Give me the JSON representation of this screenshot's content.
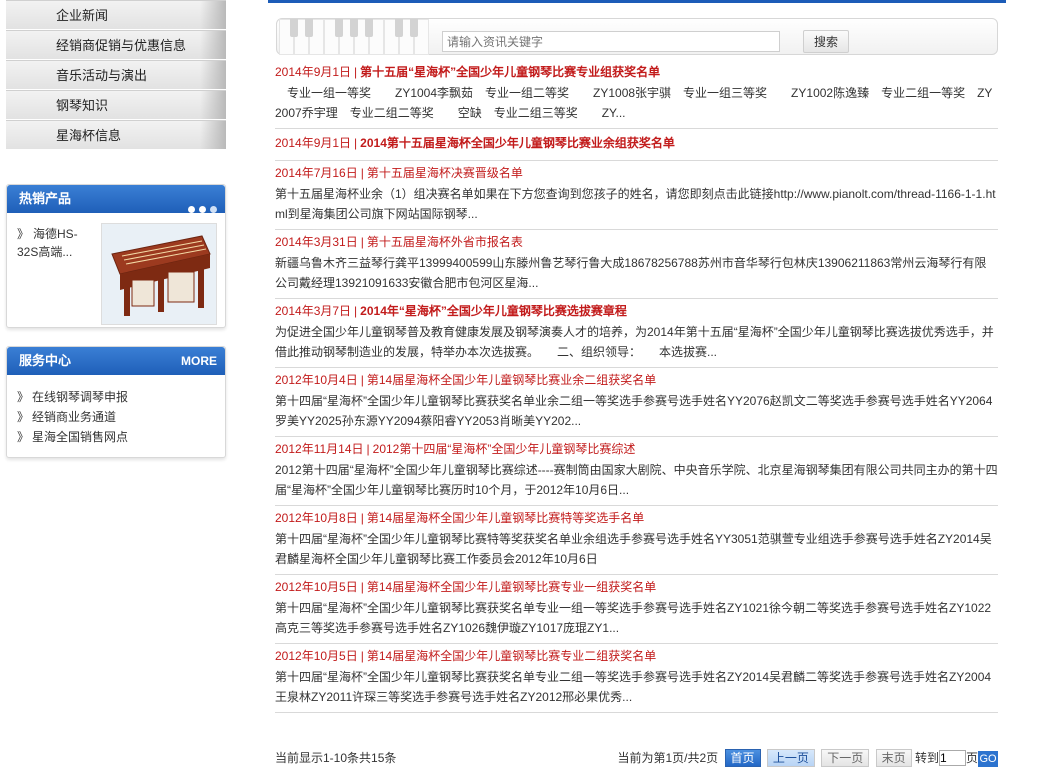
{
  "categories": [
    "企业新闻",
    "经销商促销与优惠信息",
    "音乐活动与演出",
    "钢琴知识",
    "星海杯信息"
  ],
  "hot_products": {
    "title": "热销产品",
    "product_label": "海德HS-32S高端...",
    "product_image_icon": "product-photo"
  },
  "service_center": {
    "title": "服务中心",
    "more": "MORE",
    "links": [
      "在线钢琴调琴申报",
      "经销商业务通道",
      "星海全国销售网点"
    ]
  },
  "search": {
    "placeholder": "请输入资讯关键字",
    "button": "搜索"
  },
  "news": [
    {
      "date": "2014年9月1日",
      "title": "第十五届“星海杯”全国少年儿童钢琴比赛专业组获奖名单",
      "bold": true,
      "desc": "　专业一组一等奖　　ZY1004李飘茹　专业一组二等奖　　ZY1008张宇骐　专业一组三等奖　　ZY1002陈逸臻　专业二组一等奖　ZY2007乔宇理　专业二组二等奖　　空缺　专业二组三等奖　　ZY..."
    },
    {
      "date": "2014年9月1日",
      "title": "2014第十五届星海杯全国少年儿童钢琴比赛业余组获奖名单",
      "bold": true,
      "desc": ""
    },
    {
      "date": "2014年7月16日",
      "title": "第十五届星海杯决赛晋级名单",
      "bold": false,
      "desc": "第十五届星海杯业余（1）组决赛名单如果在下方您查询到您孩子的姓名，请您即刻点击此链接http://www.pianolt.com/thread-1166-1-1.html到星海集团公司旗下网站国际钢琴..."
    },
    {
      "date": "2014年3月31日",
      "title": "第十五届星海杯外省市报名表",
      "bold": false,
      "desc": "新疆乌鲁木齐三益琴行龚平13999400599山东滕州鲁艺琴行鲁大成18678256788苏州市音华琴行包林庆13906211863常州云海琴行有限公司戴经理13921091633安徽合肥市包河区星海..."
    },
    {
      "date": "2014年3月7日",
      "title": "2014年“星海杯”全国少年儿童钢琴比赛选拔赛章程",
      "bold": true,
      "desc": "为促进全国少年儿童钢琴普及教育健康发展及钢琴演奏人才的培养，为2014年第十五届“星海杯”全国少年儿童钢琴比赛选拔优秀选手，并借此推动钢琴制造业的发展，特举办本次选拔赛。　　二、组织领导：　　本选拔赛..."
    },
    {
      "date": "2012年10月4日",
      "title": "第14届星海杯全国少年儿童钢琴比赛业余二组获奖名单",
      "bold": false,
      "desc": "第十四届“星海杯”全国少年儿童钢琴比赛获奖名单业余二组一等奖选手参赛号选手姓名YY2076赵凯文二等奖选手参赛号选手姓名YY2064罗美YY2025孙东源YY2094蔡阳睿YY2053肖晰美YY202..."
    },
    {
      "date": "2012年11月14日",
      "title": "2012第十四届“星海杯”全国少年儿童钢琴比赛综述",
      "bold": false,
      "desc": "2012第十四届“星海杯”全国少年儿童钢琴比赛综述----赛制筒由国家大剧院、中央音乐学院、北京星海钢琴集团有限公司共同主办的第十四届“星海杯”全国少年儿童钢琴比赛历时10个月，于2012年10月6日..."
    },
    {
      "date": "2012年10月8日",
      "title": "第14届星海杯全国少年儿童钢琴比赛特等奖选手名单",
      "bold": false,
      "desc": "第十四届“星海杯”全国少年儿童钢琴比赛特等奖获奖名单业余组选手参赛号选手姓名YY3051范骐萱专业组选手参赛号选手姓名ZY2014吴君麟星海杯全国少年儿童钢琴比赛工作委员会2012年10月6日"
    },
    {
      "date": "2012年10月5日",
      "title": "第14届星海杯全国少年儿童钢琴比赛专业一组获奖名单",
      "bold": false,
      "desc": "第十四届“星海杯”全国少年儿童钢琴比赛获奖名单专业一组一等奖选手参赛号选手姓名ZY1021徐今朝二等奖选手参赛号选手姓名ZY1022高克三等奖选手参赛号选手姓名ZY1026魏伊璇ZY1017庞琨ZY1..."
    },
    {
      "date": "2012年10月5日",
      "title": "第14届星海杯全国少年儿童钢琴比赛专业二组获奖名单",
      "bold": false,
      "desc": "第十四届“星海杯”全国少年儿童钢琴比赛获奖名单专业二组一等奖选手参赛号选手姓名ZY2014吴君麟二等奖选手参赛号选手姓名ZY2004王泉林ZY2011许琛三等奖选手参赛号选手姓名ZY2012邢必果优秀..."
    }
  ],
  "pager": {
    "count_text": "当前显示1-10条共15条",
    "page_text": "当前为第1页/共2页",
    "first": "首页",
    "prev": "上一页",
    "next": "下一页",
    "last": "末页",
    "jump_label": "转到",
    "jump_value": "1",
    "page_unit": "页",
    "go": "GO"
  },
  "colors": {
    "accent_blue": "#1f5fb8",
    "news_red": "#c21b1b"
  }
}
